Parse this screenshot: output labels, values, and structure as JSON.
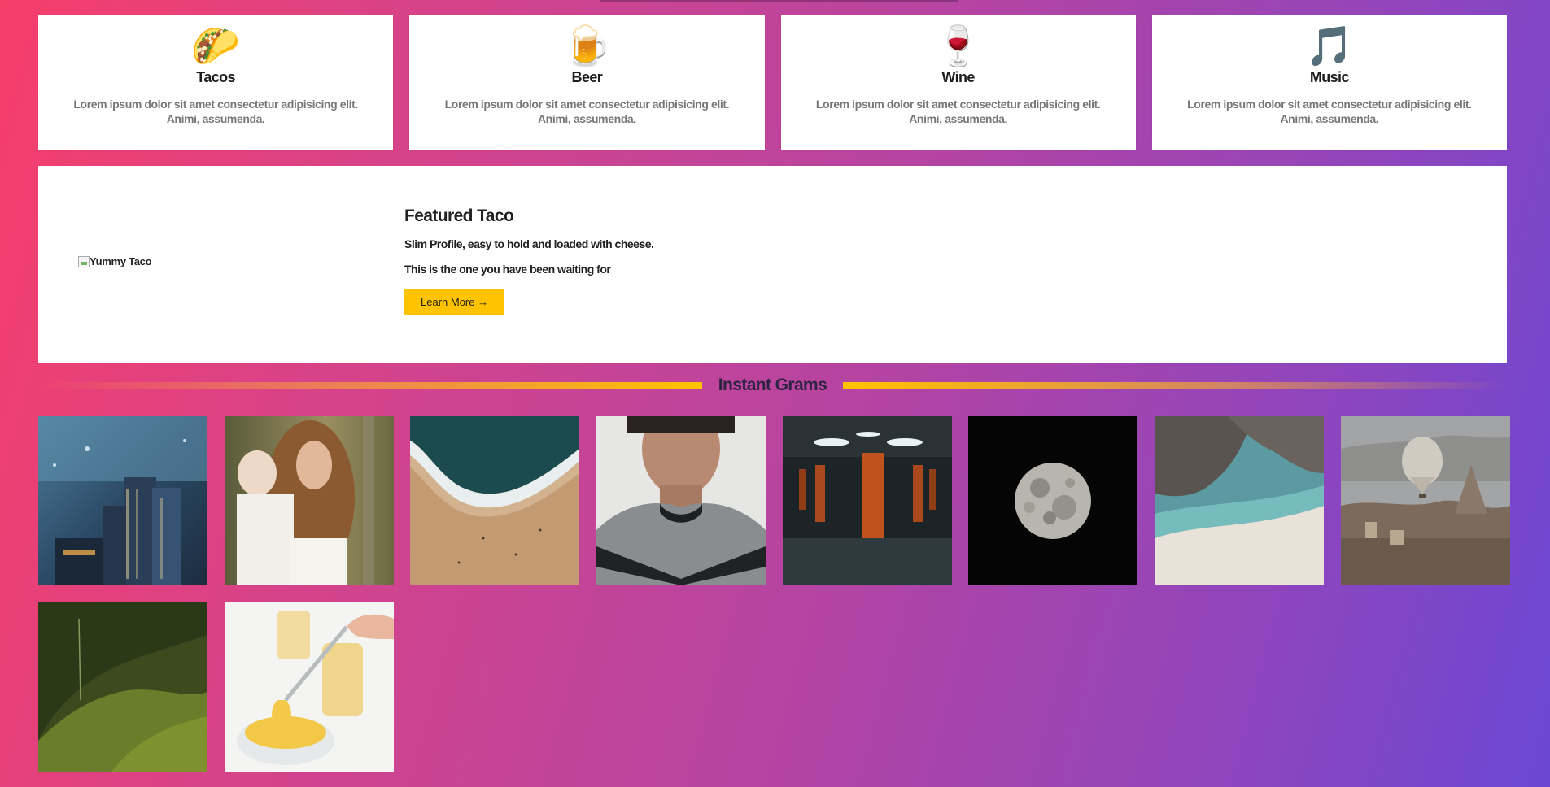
{
  "features": [
    {
      "icon": "taco-icon",
      "emoji": "🌮",
      "title": "Tacos",
      "text": "Lorem ipsum dolor sit amet consectetur adipisicing elit. Animi, assumenda."
    },
    {
      "icon": "beer-icon",
      "emoji": "🍺",
      "title": "Beer",
      "text": "Lorem ipsum dolor sit amet consectetur adipisicing elit. Animi, assumenda."
    },
    {
      "icon": "wine-icon",
      "emoji": "🍷",
      "title": "Wine",
      "text": "Lorem ipsum dolor sit amet consectetur adipisicing elit. Animi, assumenda."
    },
    {
      "icon": "music-icon",
      "emoji": "🎵",
      "title": "Music",
      "text": "Lorem ipsum dolor sit amet consectetur adipisicing elit. Animi, assumenda."
    }
  ],
  "featured": {
    "image_alt": "Yummy Taco",
    "title": "Featured Taco",
    "line1": "Slim Profile, easy to hold and loaded with cheese.",
    "line2": "This is the one you have been waiting for",
    "button_label": "Learn More →"
  },
  "grams": {
    "title": "Instant Grams",
    "photos": [
      "city-skyline-photo",
      "mother-child-photo",
      "beach-shore-photo",
      "man-portrait-photo",
      "parking-garage-photo",
      "full-moon-photo",
      "rocky-cove-photo",
      "hot-air-balloon-photo",
      "green-valley-photo",
      "custard-spoon-photo"
    ]
  },
  "colors": {
    "accent": "#ffc300",
    "gradient_start": "#f63e6a",
    "gradient_end": "#6b47d4"
  }
}
